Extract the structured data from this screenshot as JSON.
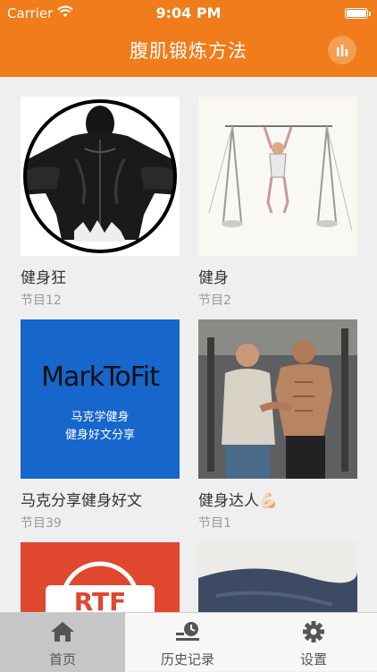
{
  "status_bar": {
    "carrier": "Carrier",
    "time": "9:04 PM"
  },
  "nav": {
    "title": "腹肌锻炼方法",
    "right_icon": "bar-chart-icon"
  },
  "colors": {
    "primary": "#f07c1b",
    "tab_active_bg": "#c6c6c6"
  },
  "cards": [
    {
      "title": "健身狂",
      "subtitle": "节目12"
    },
    {
      "title": "健身",
      "subtitle": "节目2"
    },
    {
      "title": "马克分享健身好文",
      "subtitle": "节目39",
      "image_text": "MarkToFit",
      "image_sub1": "马克学健身",
      "image_sub2": "健身好文分享"
    },
    {
      "title": "健身达人💪🏻",
      "subtitle": "节目1"
    },
    {
      "title": "",
      "subtitle": "",
      "image_text": "RTF"
    },
    {
      "title": "",
      "subtitle": ""
    }
  ],
  "tabs": [
    {
      "label": "首页",
      "icon": "home-icon",
      "active": true
    },
    {
      "label": "历史记录",
      "icon": "history-icon",
      "active": false
    },
    {
      "label": "设置",
      "icon": "settings-icon",
      "active": false
    }
  ]
}
